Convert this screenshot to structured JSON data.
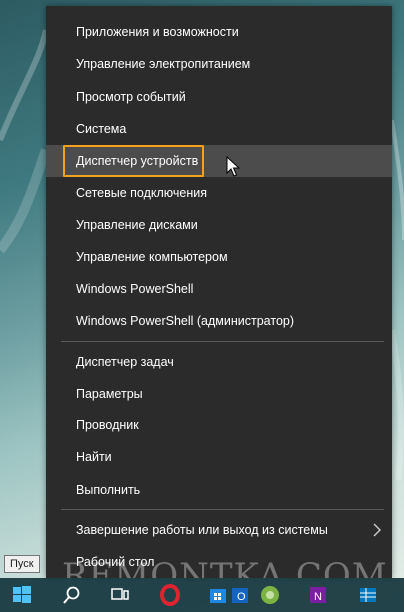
{
  "menu": {
    "items": [
      {
        "label": "Приложения и возможности"
      },
      {
        "label": "Управление электропитанием"
      },
      {
        "label": "Просмотр событий"
      },
      {
        "label": "Система"
      },
      {
        "label": "Диспетчер устройств"
      },
      {
        "label": "Сетевые подключения"
      },
      {
        "label": "Управление дисками"
      },
      {
        "label": "Управление компьютером"
      },
      {
        "label": "Windows PowerShell"
      },
      {
        "label": "Windows PowerShell (администратор)"
      },
      {
        "label": "Диспетчер задач"
      },
      {
        "label": "Параметры"
      },
      {
        "label": "Проводник"
      },
      {
        "label": "Найти"
      },
      {
        "label": "Выполнить"
      },
      {
        "label": "Завершение работы или выход из системы"
      },
      {
        "label": "Рабочий стол"
      }
    ],
    "hovered_item": "Диспетчер устройств",
    "highlight_color": "#f4a21d",
    "background": "#2b2b2b"
  },
  "tooltip": {
    "text": "Пуск"
  },
  "watermark": {
    "text": "REMONTKA.COM"
  },
  "taskbar": {
    "icons": [
      "windows-start-icon",
      "search-icon",
      "task-view-icon",
      "opera-icon",
      "windows-store-icon",
      "outlook-icon",
      "green-app-icon",
      "onenote-icon",
      "grid-app-icon"
    ]
  }
}
